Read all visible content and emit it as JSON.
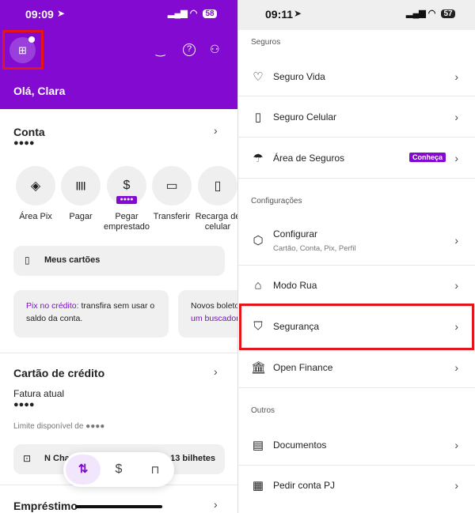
{
  "left": {
    "status": {
      "time": "09:09",
      "battery": "58"
    },
    "header": {
      "greeting": "Olá, Clara",
      "icons": [
        "add-photo-icon",
        "eye-closed-icon",
        "help-icon",
        "profile-icon"
      ]
    },
    "account": {
      "title": "Conta",
      "balance": "●●●●"
    },
    "actions": [
      {
        "label": "Área Pix",
        "icon": "pix-icon"
      },
      {
        "label": "Pagar",
        "icon": "barcode-icon"
      },
      {
        "label": "Pegar emprestado",
        "icon": "loan-icon",
        "badge": "●●●●"
      },
      {
        "label": "Transferir",
        "icon": "transfer-icon"
      },
      {
        "label": "Recarga de celular",
        "icon": "phone-icon"
      }
    ],
    "my_cards": "Meus cartões",
    "promos": [
      {
        "highlight": "Pix no crédito:",
        "text": " transfira sem usar o saldo da conta."
      },
      {
        "text": "Novos boleto",
        "highlight": "um buscador"
      }
    ],
    "credit": {
      "title": "Cartão de crédito",
      "invoice_label": "Fatura atual",
      "invoice_value": "●●●●",
      "limit": "Limite disponível de ●●●●"
    },
    "tickets": {
      "label": "N Cha",
      "count": "13 bilhetes"
    },
    "loan": "Empréstimo",
    "bottom_nav": [
      {
        "icon": "transfer-arrows-icon",
        "active": true
      },
      {
        "icon": "dollar-icon"
      },
      {
        "icon": "shopping-bag-icon"
      }
    ]
  },
  "right": {
    "status": {
      "time": "09:11",
      "battery": "57"
    },
    "sections": {
      "insurance": "Seguros",
      "settings": "Configurações",
      "others": "Outros"
    },
    "items": [
      {
        "label": "Seguro Vida",
        "icon": "heart-icon"
      },
      {
        "label": "Seguro Celular",
        "icon": "phone-icon"
      },
      {
        "label": "Área de Seguros",
        "icon": "umbrella-icon",
        "badge": "Conheça"
      },
      {
        "label": "Configurar",
        "icon": "settings-icon",
        "subtitle": "Cartão, Conta, Pix, Perfil"
      },
      {
        "label": "Modo Rua",
        "icon": "street-mode-icon"
      },
      {
        "label": "Segurança",
        "icon": "shield-icon",
        "highlighted": true
      },
      {
        "label": "Open Finance",
        "icon": "bank-icon"
      },
      {
        "label": "Documentos",
        "icon": "document-icon"
      },
      {
        "label": "Pedir conta PJ",
        "icon": "building-icon"
      }
    ]
  },
  "colors": {
    "brand": "#820ad1",
    "highlight": "#e3161c"
  }
}
